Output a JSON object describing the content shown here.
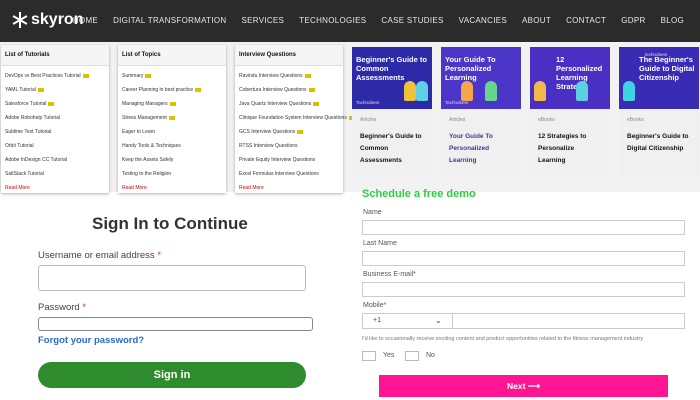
{
  "header": {
    "logo_text": "skyron",
    "nav": [
      "HOME",
      "DIGITAL TRANSFORMATION",
      "SERVICES",
      "TECHNOLOGIES",
      "CASE STUDIES",
      "VACANCIES",
      "ABOUT",
      "CONTACT",
      "GDPR",
      "BLOG"
    ]
  },
  "dropdown": {
    "columns": [
      {
        "title": "List of Tutorials",
        "items": [
          "DevOps vs Best Practices Tutorial",
          "YAML Tutorial",
          "Salesforce Tutorial",
          "Adobe Robohelp Tutorial",
          "Sublime Text Tutorial",
          "Orbit Tutorial",
          "Adobe InDesign CC Tutorial",
          "SaltStack Tutorial"
        ],
        "more": "Read More"
      },
      {
        "title": "List of Topics",
        "items": [
          "Summary",
          "Career Planning in best practice",
          "Managing Managers",
          "Stress Management",
          "Eager to Learn",
          "Handy Tools & Techniques",
          "Keep the Assets Safely",
          "Testing to the Religion"
        ],
        "more": "Read More"
      },
      {
        "title": "Interview Questions",
        "items": [
          "Ravindu Interview Questions",
          "Cobertura Interview Questions",
          "Java Quartz Interview Questions",
          "Clinique Foundation System Interview Questions",
          "GCS Interview Questions",
          "RTSS Interview Questions",
          "Private Equity Interview Questions",
          "Excel Formulas Interview Questions"
        ],
        "more": "Read More"
      }
    ]
  },
  "cards": [
    {
      "image_title": "Beginner's Guide to Common Assessments",
      "image_brand": "Tachnobeer",
      "category": "Articles",
      "title": "Beginner's Guide to Common Assessments",
      "color": "#2d2aa8"
    },
    {
      "image_title": "Your Guide To Personalized Learning",
      "image_brand": "Tachnobeer",
      "category": "Articles",
      "title": "Your Guide To Personalized Learning",
      "color": "#4b36c9"
    },
    {
      "image_title": "12 Personalized Learning Strategie",
      "image_brand": "",
      "category": "eBooks",
      "title": "12 Strategies to Personalize Learning",
      "color": "#4a2fc4"
    },
    {
      "image_title": "The Beginner's Guide to Digital Citizenship",
      "image_brand": "technobeer",
      "category": "eBooks",
      "title": "Beginner's Guide to Digital Citizenship",
      "color": "#3a2bb5"
    }
  ],
  "signin": {
    "title": "Sign In to Continue",
    "username_label": "Username or email address",
    "password_label": "Password",
    "required_mark": "*",
    "forgot": "Forgot your password?",
    "button": "Sign in"
  },
  "demo": {
    "title": "Schedule a free demo",
    "name_label": "Name",
    "lastname_label": "Last Name",
    "email_label": "Business E-mail*",
    "mobile_label": "Mobile*",
    "country_code": "+1",
    "consent": "I'd like to occasionally receive exciting content and product opportunities related to the fitness management industry",
    "yes": "Yes",
    "no": "No",
    "next": "Next",
    "next_arrow": "⟶"
  }
}
